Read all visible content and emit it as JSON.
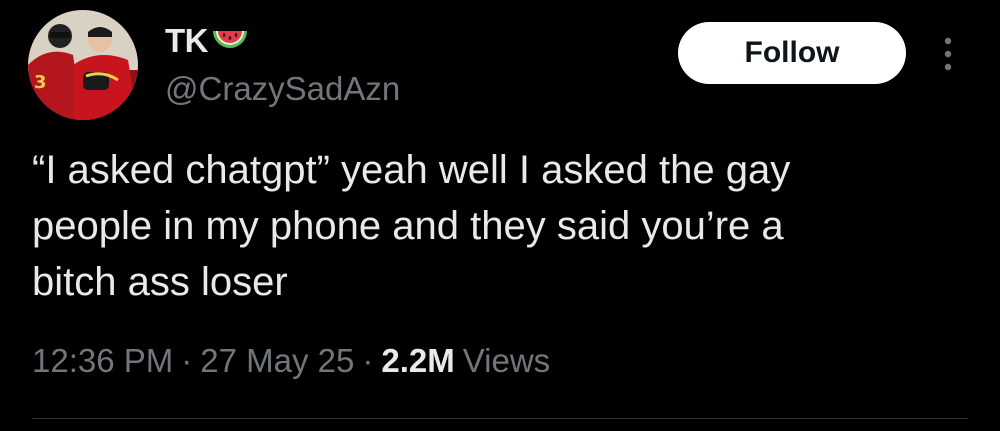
{
  "tweet": {
    "display_name": "TK",
    "name_emoji": "watermelon-icon",
    "handle": "@CrazySadAzn",
    "follow_label": "Follow",
    "more_icon": "more-vertical-icon",
    "text": "“I asked chatgpt” yeah well I asked the gay\npeople in my phone and they said you’re a\nbitch ass loser",
    "time": "12:36 PM",
    "date": "27 May 25",
    "views_count": "2.2M",
    "views_label": "Views",
    "separator": "·"
  },
  "colors": {
    "background": "#000000",
    "primary_text": "#e7e9ea",
    "secondary_text": "#71767b",
    "follow_button_bg": "#ffffff",
    "follow_button_text": "#0f1419",
    "divider": "#2f3336"
  }
}
